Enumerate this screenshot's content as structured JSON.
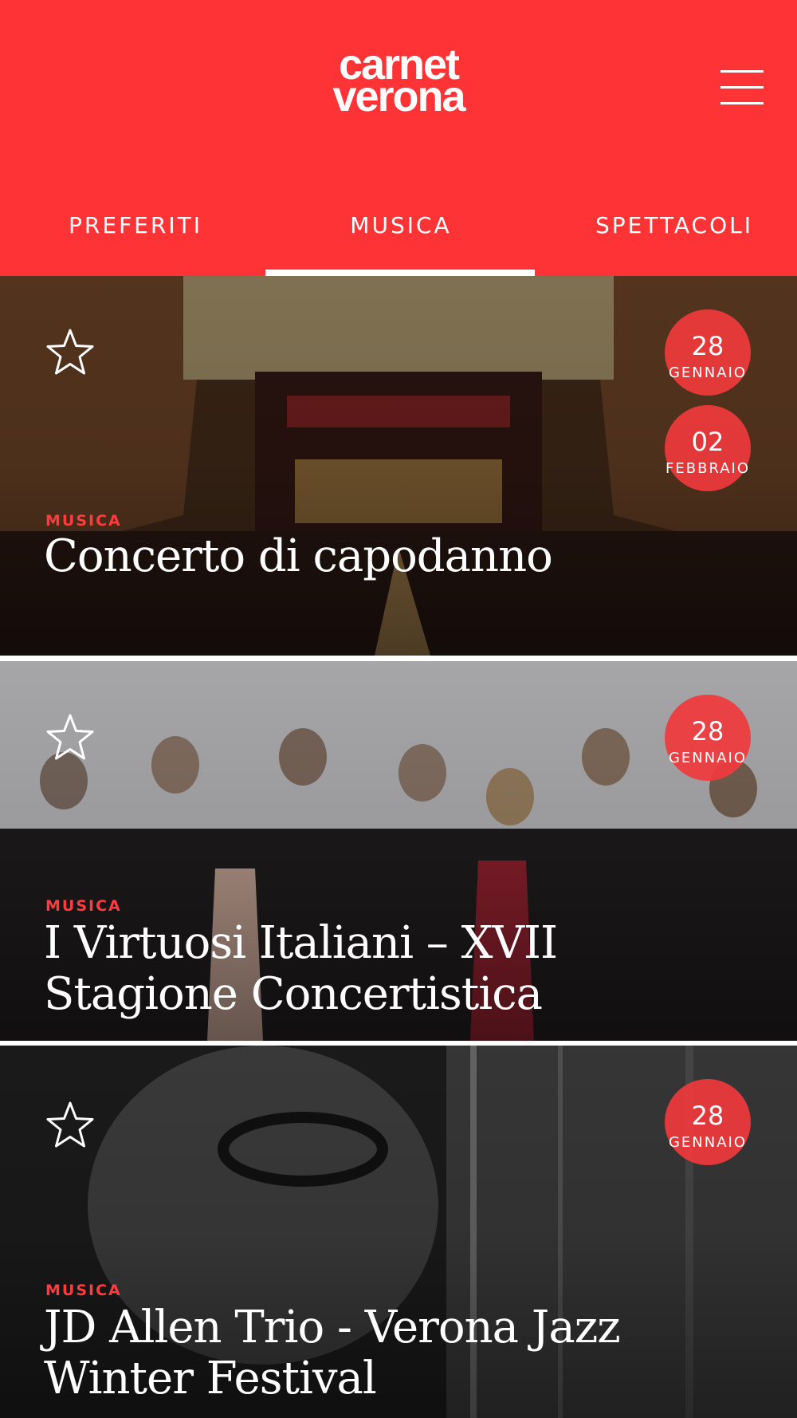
{
  "header": {
    "logo_line1": "carnet",
    "logo_line2": "verona",
    "bg_color": "#fd3336"
  },
  "menu": {
    "icon": "hamburger-menu-icon"
  },
  "tabs": [
    {
      "label": "PREFERITI",
      "active": false
    },
    {
      "label": "MUSICA",
      "active": true
    },
    {
      "label": "SPETTACOLI",
      "active": false
    }
  ],
  "events": [
    {
      "category": "MUSICA",
      "title": "Concerto di capodanno",
      "favorite_icon": "star-outline-icon",
      "dates": [
        {
          "day": "28",
          "month": "GENNAIO"
        },
        {
          "day": "02",
          "month": "FEBBRAIO"
        }
      ]
    },
    {
      "category": "MUSICA",
      "title_line1": "I Virtuosi Italiani – XVII",
      "title_line2": "Stagione Concertistica",
      "favorite_icon": "star-outline-icon",
      "dates": [
        {
          "day": "28",
          "month": "GENNAIO"
        }
      ]
    },
    {
      "category": "MUSICA",
      "title_line1": "JD Allen Trio - Verona Jazz",
      "title_line2": "Winter Festival",
      "favorite_icon": "star-outline-icon",
      "dates": [
        {
          "day": "28",
          "month": "GENNAIO"
        }
      ]
    }
  ],
  "colors": {
    "accent": "#fd3336",
    "badge": "#f03a3c",
    "category": "#ff3b3e"
  }
}
